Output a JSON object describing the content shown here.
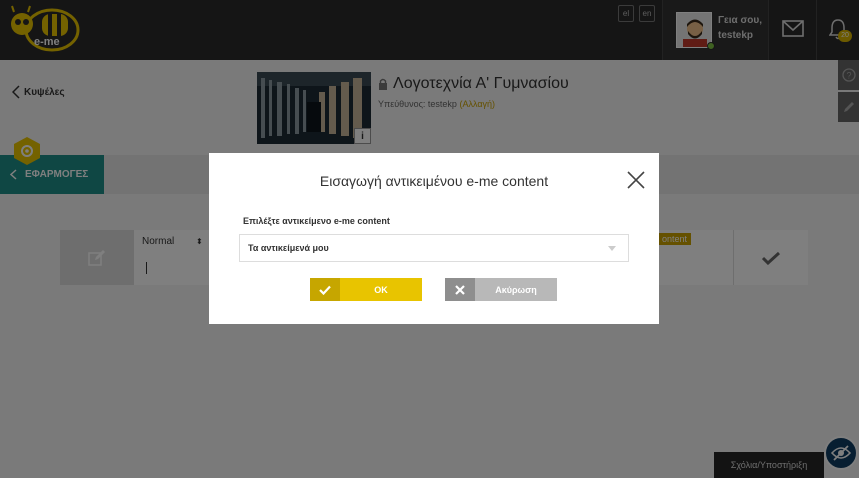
{
  "header": {
    "logo_text": "e-me",
    "langs": [
      "el",
      "en"
    ],
    "greeting_line1": "Γεια σου,",
    "greeting_line2": "testekp",
    "notification_count": "20"
  },
  "page": {
    "back_label": "Κυψέλες",
    "info_tag": "i",
    "course_title": "Λογοτεχνία Α' Γυμνασίου",
    "responsible_label": "Υπεύθυνος: testekp",
    "change_label": "(Αλλαγή)",
    "apps_label": "ΕΦΑΡΜΟΓΕΣ"
  },
  "editor": {
    "format_select": "Normal",
    "content_tag": "ontent"
  },
  "modal": {
    "title": "Εισαγωγή αντικειμένου e-me content",
    "field_label": "Επιλέξτε αντικείμενο e-me content",
    "select_value": "Τα αντικείμενά μου",
    "ok_label": "OK",
    "cancel_label": "Ακύρωση"
  },
  "footer": {
    "support_label": "Σχόλια/Υποστήριξη"
  },
  "colors": {
    "accent_yellow": "#e8c400",
    "teal": "#1f8f88",
    "topbar": "#2b2b2b"
  }
}
